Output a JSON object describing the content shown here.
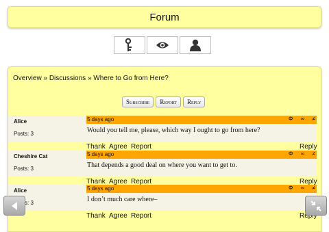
{
  "header": {
    "title": "Forum"
  },
  "toolbar": {
    "icons": [
      "key-icon",
      "eye-icon",
      "user-icon"
    ]
  },
  "breadcrumb": {
    "items": [
      "Overview",
      "Discussions",
      "Where to Go from Here?"
    ],
    "separator": "»"
  },
  "actions": {
    "subscribe": "Subscribe",
    "report": "Report",
    "reply": "Reply"
  },
  "posts": [
    {
      "author": "Alice",
      "posts_count": "Posts: 3",
      "time": "5 days ago",
      "body": "Would you tell me, please, which way I ought to go from here?",
      "icons": [
        "Φ",
        "∞",
        "≠"
      ]
    },
    {
      "author": "Cheshire Cat",
      "posts_count": "Posts: 3",
      "time": "5 days ago",
      "body": "That depends a good deal on where you want to get to.",
      "icons": [
        "Φ",
        "∞",
        "≠"
      ]
    },
    {
      "author": "Alice",
      "posts_count": "Posts: 3",
      "time": "5 days ago",
      "body": "I don’t much care where–",
      "icons": [
        "Φ",
        "∞",
        "≠"
      ]
    }
  ],
  "post_links": {
    "thank": "Thank",
    "agree": "Agree",
    "report": "Report",
    "reply": "Reply"
  },
  "colors": {
    "panel": "#ffffa0",
    "meta_bar": "#ffa500",
    "post_bg": "#f4f3e6"
  }
}
